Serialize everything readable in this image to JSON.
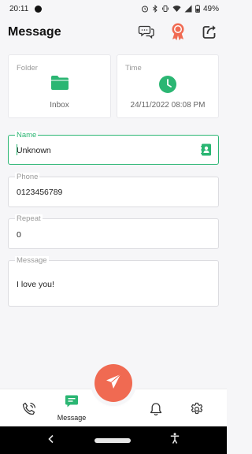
{
  "status_bar": {
    "time": "20:11",
    "battery": "49%"
  },
  "app_bar": {
    "title": "Message"
  },
  "cards": {
    "folder": {
      "label": "Folder",
      "value": "Inbox"
    },
    "time": {
      "label": "Time",
      "value": "24/11/2022 08:08 PM"
    }
  },
  "fields": {
    "name": {
      "label": "Name",
      "value": "Unknown"
    },
    "phone": {
      "label": "Phone",
      "value": "0123456789"
    },
    "repeat": {
      "label": "Repeat",
      "value": "0"
    },
    "message": {
      "label": "Message",
      "value": "I love you!"
    }
  },
  "bottom_nav": {
    "message_label": "Message"
  },
  "colors": {
    "accent": "#2bb673",
    "fab": "#f06a52",
    "badge": "#f06a52"
  },
  "icons": [
    "chat-icon",
    "award-icon",
    "share-icon",
    "folder-icon",
    "clock-icon",
    "contact-book-icon",
    "phone-call-icon",
    "message-icon",
    "send-icon",
    "bell-icon",
    "gear-icon",
    "back-icon",
    "accessibility-icon"
  ]
}
